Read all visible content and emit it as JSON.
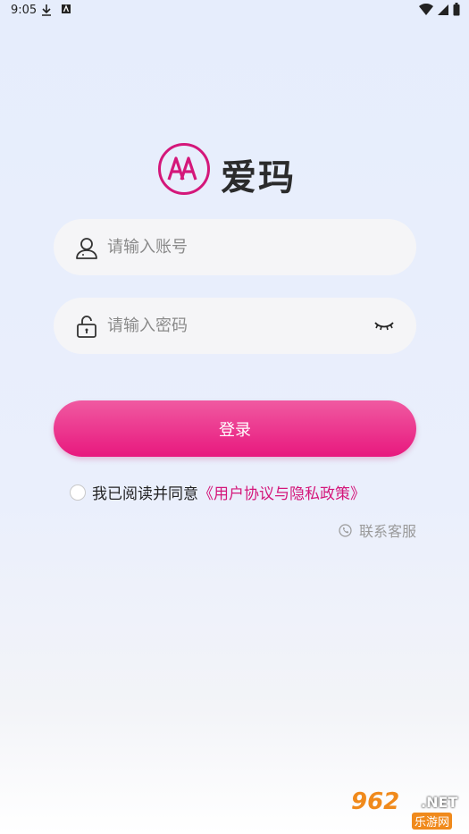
{
  "status_bar": {
    "time": "9:05"
  },
  "brand": {
    "name": "爱玛",
    "accent_color": "#d4177a"
  },
  "form": {
    "account_placeholder": "请输入账号",
    "password_placeholder": "请输入密码",
    "login_label": "登录"
  },
  "agreement": {
    "prefix": "我已阅读并同意",
    "link": "《用户协议与隐私政策》"
  },
  "service": {
    "label": "联系客服"
  },
  "watermark": {
    "main": "962",
    "suffix": ".NET",
    "sub": "乐游网"
  }
}
